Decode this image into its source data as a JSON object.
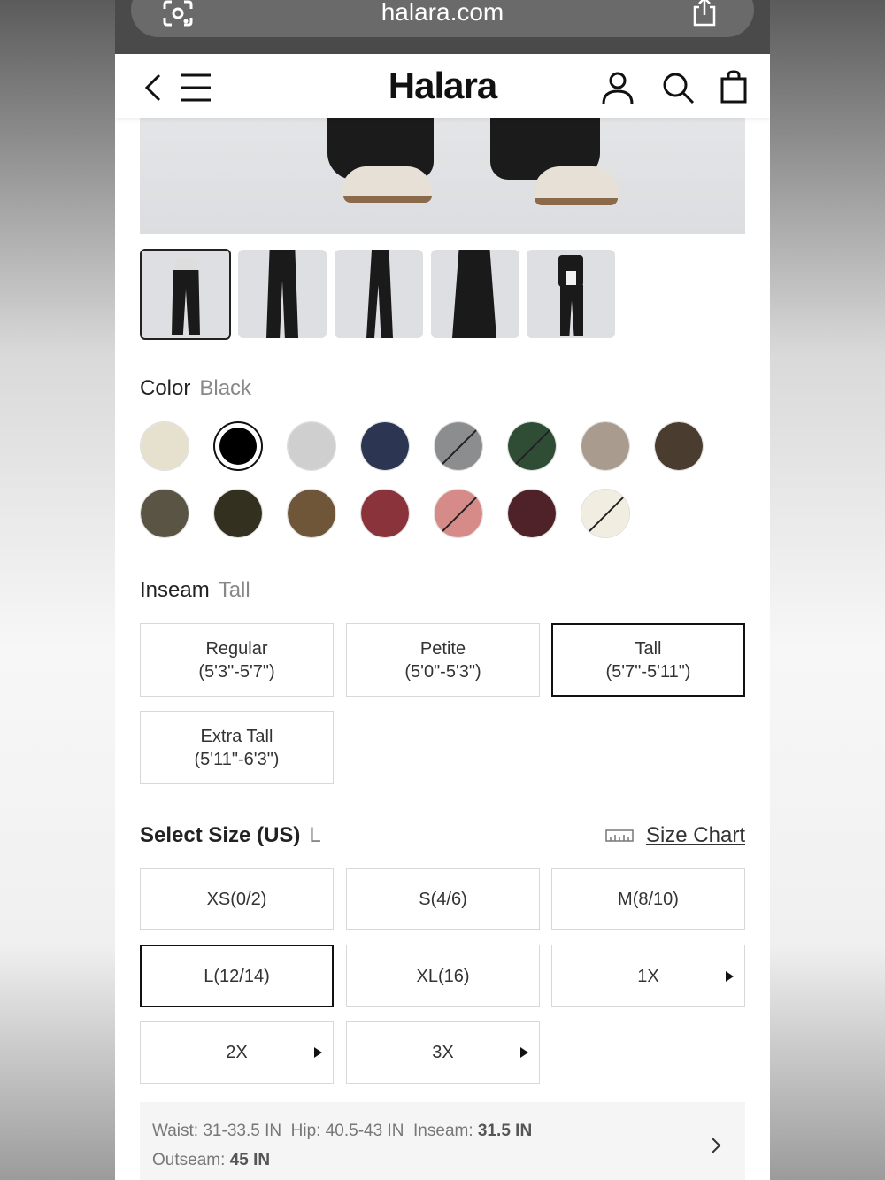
{
  "browser": {
    "url": "halara.com"
  },
  "header": {
    "logo": "Halara"
  },
  "color": {
    "label": "Color",
    "selected": "Black",
    "swatches": [
      {
        "hex": "#e6e0cf",
        "available": true
      },
      {
        "hex": "#000000",
        "available": true,
        "selected": true
      },
      {
        "hex": "#cfcfcf",
        "available": true
      },
      {
        "hex": "#2c3552",
        "available": true
      },
      {
        "hex": "#8b8d8f",
        "available": false
      },
      {
        "hex": "#2f4d35",
        "available": false
      },
      {
        "hex": "#a99b8d",
        "available": true
      },
      {
        "hex": "#4a3d2f",
        "available": true
      },
      {
        "hex": "#5a5444",
        "available": true
      },
      {
        "hex": "#33301f",
        "available": true
      },
      {
        "hex": "#6f5638",
        "available": true
      },
      {
        "hex": "#8a333a",
        "available": true
      },
      {
        "hex": "#d68b89",
        "available": false
      },
      {
        "hex": "#4f2229",
        "available": true
      },
      {
        "hex": "#f1ede0",
        "available": false
      }
    ]
  },
  "inseam": {
    "label": "Inseam",
    "selected": "Tall",
    "options": [
      {
        "name": "Regular",
        "range": "(5'3\"-5'7\")"
      },
      {
        "name": "Petite",
        "range": "(5'0\"-5'3\")"
      },
      {
        "name": "Tall",
        "range": "(5'7\"-5'11\")"
      },
      {
        "name": "Extra Tall",
        "range": "(5'11\"-6'3\")"
      }
    ]
  },
  "size": {
    "label": "Select Size (US)",
    "selected": "L",
    "size_chart": "Size Chart",
    "options": [
      "XS(0/2)",
      "S(4/6)",
      "M(8/10)",
      "L(12/14)",
      "XL(16)",
      "1X",
      "2X",
      "3X"
    ]
  },
  "measurements": {
    "waist_label": "Waist:",
    "waist": "31-33.5 IN",
    "hip_label": "Hip:",
    "hip": "40.5-43 IN",
    "inseam_label": "Inseam:",
    "inseam": "31.5 IN",
    "outseam_label": "Outseam:",
    "outseam": "45 IN"
  }
}
